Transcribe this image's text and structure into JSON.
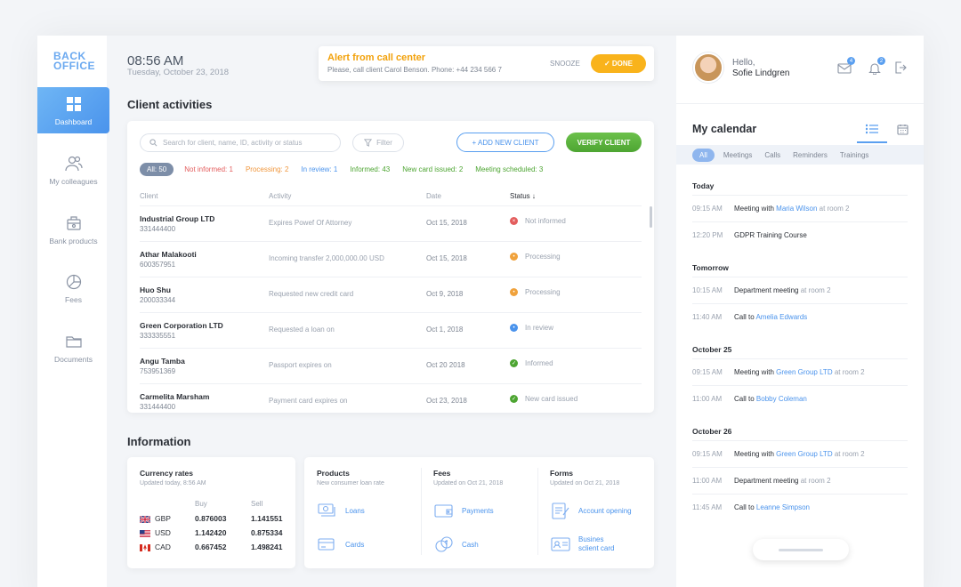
{
  "logo": {
    "line1": "BACK",
    "line2": "OFFICE"
  },
  "nav": [
    {
      "label": "Dashboard",
      "icon": "grid-icon"
    },
    {
      "label": "My colleagues",
      "icon": "people-icon"
    },
    {
      "label": "Bank products",
      "icon": "box-icon"
    },
    {
      "label": "Fees",
      "icon": "pie-icon"
    },
    {
      "label": "Documents",
      "icon": "folder-icon"
    }
  ],
  "header": {
    "time": "08:56 AM",
    "date": "Tuesday, October 23, 2018"
  },
  "alert": {
    "title": "Alert from call center",
    "text": "Please, call client Carol Benson. Phone: +44 234 566 7",
    "snooze": "SNOOZE",
    "done": "✓ DONE"
  },
  "activities": {
    "title": "Client activities",
    "search_placeholder": "Search for client, name, ID, activity or status",
    "filter": "Filter",
    "add_client": "+ ADD NEW CLIENT",
    "verify_client": "VERIFY CLIENT",
    "chips": [
      {
        "label": "All: 50",
        "color": "#ffffff"
      },
      {
        "label": "Not informed: 1",
        "color": "#e35d5d"
      },
      {
        "label": "Processing: 2",
        "color": "#f0963c"
      },
      {
        "label": "In review: 1",
        "color": "#4a93ec"
      },
      {
        "label": "Informed: 43",
        "color": "#4da532"
      },
      {
        "label": "New card issued: 2",
        "color": "#4da532"
      },
      {
        "label": "Meeting scheduled: 3",
        "color": "#4da532"
      }
    ],
    "columns": {
      "client": "Client",
      "activity": "Activity",
      "date": "Date",
      "status": "Status ↓"
    },
    "rows": [
      {
        "name": "Industrial Group LTD",
        "id": "331444400",
        "activity": "Expires Powef Of Attorney",
        "date": "Oct 15, 2018",
        "status": "Not informed",
        "status_color": "#e35d5d",
        "glyph": "×"
      },
      {
        "name": "Athar Malakooti",
        "id": "600357951",
        "activity": "Incoming transfer 2,000,000.00 USD",
        "date": "Oct 15, 2018",
        "status": "Processing",
        "status_color": "#f0a23c",
        "glyph": "•"
      },
      {
        "name": "Huo Shu",
        "id": "200033344",
        "activity": "Requested new credit card",
        "date": "Oct 9, 2018",
        "status": "Processing",
        "status_color": "#f0a23c",
        "glyph": "•"
      },
      {
        "name": "Green Corporation LTD",
        "id": "333335551",
        "activity": "Requested a loan on",
        "date": "Oct 1, 2018",
        "status": "In review",
        "status_color": "#4a93ec",
        "glyph": "•"
      },
      {
        "name": "Angu Tamba",
        "id": "753951369",
        "activity": "Passport expires on",
        "date": "Oct 20 2018",
        "status": "Informed",
        "status_color": "#4da532",
        "glyph": "✓"
      },
      {
        "name": "Carmelita Marsham",
        "id": "331444400",
        "activity": "Payment card expires on",
        "date": "Oct 23, 2018",
        "status": "New card issued",
        "status_color": "#4da532",
        "glyph": "✓"
      }
    ]
  },
  "information": {
    "title": "Information",
    "currency": {
      "title": "Currency rates",
      "updated": "Updated today, 8:56 AM",
      "buy": "Buy",
      "sell": "Sell",
      "rows": [
        {
          "cur": "GBP",
          "buy": "0.876003",
          "sell": "1.141551"
        },
        {
          "cur": "USD",
          "buy": "1.142420",
          "sell": "0.875334"
        },
        {
          "cur": "CAD",
          "buy": "0.667452",
          "sell": "1.498241"
        }
      ]
    },
    "products": {
      "title": "Products",
      "sub": "New consumer loan rate",
      "links": [
        "Loans",
        "Cards"
      ]
    },
    "fees": {
      "title": "Fees",
      "sub": "Updated on Oct 21, 2018",
      "links": [
        "Payments",
        "Cash"
      ]
    },
    "forms": {
      "title": "Forms",
      "sub": "Updated on Oct 21, 2018",
      "links": [
        "Account opening",
        "Busines",
        "sclient card"
      ]
    }
  },
  "user": {
    "hello": "Hello,",
    "name": "Sofie Lindgren",
    "messages_badge": "4",
    "notifications_badge": "2"
  },
  "calendar": {
    "title": "My calendar",
    "tabs": [
      "All",
      "Meetings",
      "Calls",
      "Reminders",
      "Trainings"
    ],
    "days": [
      {
        "label": "Today",
        "events": [
          {
            "time": "09:15 AM",
            "pre": "Meeting with",
            "person": "Maria Wilson",
            "loc": "at room 2"
          },
          {
            "time": "12:20 PM",
            "pre": "GDPR Training Course",
            "person": "",
            "loc": ""
          }
        ]
      },
      {
        "label": "Tomorrow",
        "events": [
          {
            "time": "10:15 AM",
            "pre": "Department meeting",
            "person": "",
            "loc": "at room 2"
          },
          {
            "time": "11:40 AM",
            "pre": "Call to",
            "person": "Amelia Edwards",
            "loc": ""
          }
        ]
      },
      {
        "label": "October 25",
        "events": [
          {
            "time": "09:15 AM",
            "pre": "Meeting with",
            "person": "Green Group LTD",
            "loc": "at room 2"
          },
          {
            "time": "11:00 AM",
            "pre": "Call to",
            "person": "Bobby Coleman",
            "loc": ""
          }
        ]
      },
      {
        "label": "October 26",
        "events": [
          {
            "time": "09:15 AM",
            "pre": "Meeting with",
            "person": "Green Group LTD",
            "loc": "at room 2"
          },
          {
            "time": "11:00 AM",
            "pre": "Department meeting",
            "person": "",
            "loc": "at room 2"
          },
          {
            "time": "11:45 AM",
            "pre": "Call to",
            "person": "Leanne Simpson",
            "loc": ""
          }
        ]
      }
    ]
  }
}
